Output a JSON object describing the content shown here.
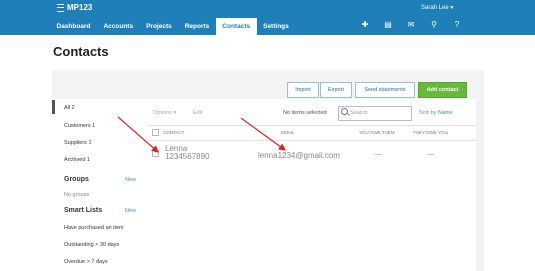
{
  "header": {
    "app_title": "MP123",
    "user": "Sarah Lee ▾",
    "nav": [
      "Dashboard",
      "Accounts",
      "Projects",
      "Reports",
      "Contacts",
      "Settings"
    ],
    "icons": [
      "plus-icon",
      "folder-icon",
      "mail-icon",
      "search-icon",
      "help-icon"
    ],
    "icon_glyphs": [
      "✚",
      "▤",
      "✉",
      "⚲",
      "?"
    ]
  },
  "page": {
    "title": "Contacts"
  },
  "actions": {
    "import": "Import",
    "export": "Export",
    "send_statements": "Send statements",
    "add_contact": "Add contact"
  },
  "sidebar": {
    "all": "All 2",
    "customers": "Customers 1",
    "suppliers": "Suppliers 1",
    "archived": "Archived 1",
    "groups_heading": "Groups",
    "groups_new": "New",
    "no_groups": "No groups",
    "smart_lists_heading": "Smart Lists",
    "smart_lists_new": "New",
    "smart_lists": [
      "Have purchased an item",
      "Outstanding > 30 days",
      "Overdue > 7 days"
    ]
  },
  "toolbar": {
    "options": "Options ▾",
    "edit": "Edit",
    "selection": "No items selected",
    "search_placeholder": "Search",
    "sort_by": "Sort by",
    "sort_value": "Name"
  },
  "table": {
    "columns": [
      "Contact",
      "Email",
      "You owe them",
      "They owe you"
    ],
    "rows": [
      {
        "name": "Lenna",
        "phone": "1234567890",
        "email": "lenna1234@gmail.com",
        "you_owe": "—",
        "they_owe": "—"
      }
    ]
  },
  "colors": {
    "brand": "#1f7fb9",
    "add_button": "#68b83c",
    "annotation": "#e02020"
  }
}
